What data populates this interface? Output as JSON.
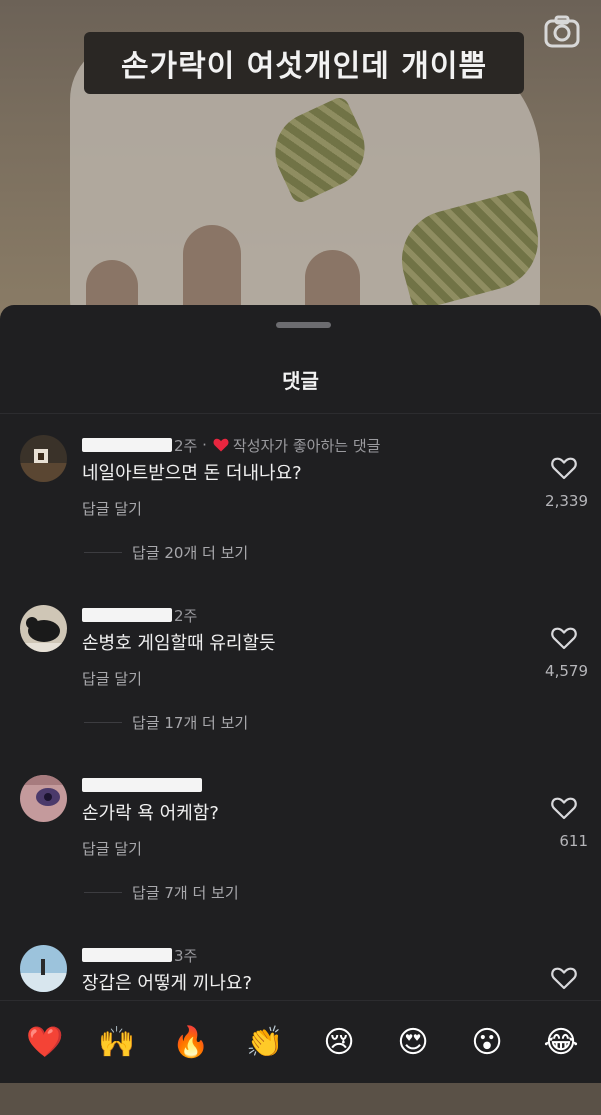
{
  "video": {
    "caption": "손가락이 여섯개인데 개이쁨",
    "camera_icon": "camera-icon"
  },
  "sheet": {
    "title": "댓글"
  },
  "comments": [
    {
      "time": "2주",
      "creator_liked": "작성자가 좋아하는 댓글",
      "text": "네일아트받으면 돈 더내나요?",
      "reply": "답글 달기",
      "likes": "2,339",
      "view_replies": "답글 20개 더 보기"
    },
    {
      "time": "2주",
      "text": "손병호 게임할때 유리할듯",
      "reply": "답글 달기",
      "likes": "4,579",
      "view_replies": "답글 17개 더 보기"
    },
    {
      "time": "",
      "text": "손가락 욕 어케함?",
      "reply": "답글 달기",
      "likes": "611",
      "view_replies": "답글 7개 더 보기"
    },
    {
      "time": "3주",
      "text": "장갑은 어떻게 끼나요?"
    }
  ],
  "emoji_bar": [
    "❤️",
    "🙌",
    "🔥",
    "👏",
    "😢",
    "😍",
    "😮",
    "😂"
  ],
  "colors": {
    "sheet_bg": "#1f1f21",
    "creator_heart": "#e8263f"
  }
}
